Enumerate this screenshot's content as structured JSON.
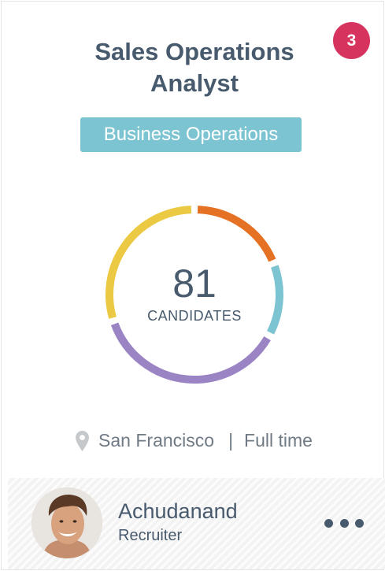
{
  "card": {
    "badge_count": "3",
    "title": "Sales Operations Analyst",
    "department": "Business Operations"
  },
  "chart_data": {
    "type": "pie",
    "variant": "donut",
    "center_value": "81",
    "center_label": "CANDIDATES",
    "series": [
      {
        "color": "#e57224",
        "fraction": 0.19
      },
      {
        "color": "#7cc4d1",
        "fraction": 0.14
      },
      {
        "color": "#9a84c4",
        "fraction": 0.37
      },
      {
        "color": "#ecc942",
        "fraction": 0.3
      }
    ]
  },
  "details": {
    "location": "San Francisco",
    "separator": "|",
    "employment_type": "Full time",
    "location_icon": "map-pin-icon"
  },
  "recruiter": {
    "name": "Achudanand",
    "role": "Recruiter",
    "menu_icon": "more-dots-icon"
  },
  "colors": {
    "badge": "#d6345f",
    "tag": "#7cc4d1",
    "text": "#485a6d",
    "muted": "#6f7a85"
  }
}
